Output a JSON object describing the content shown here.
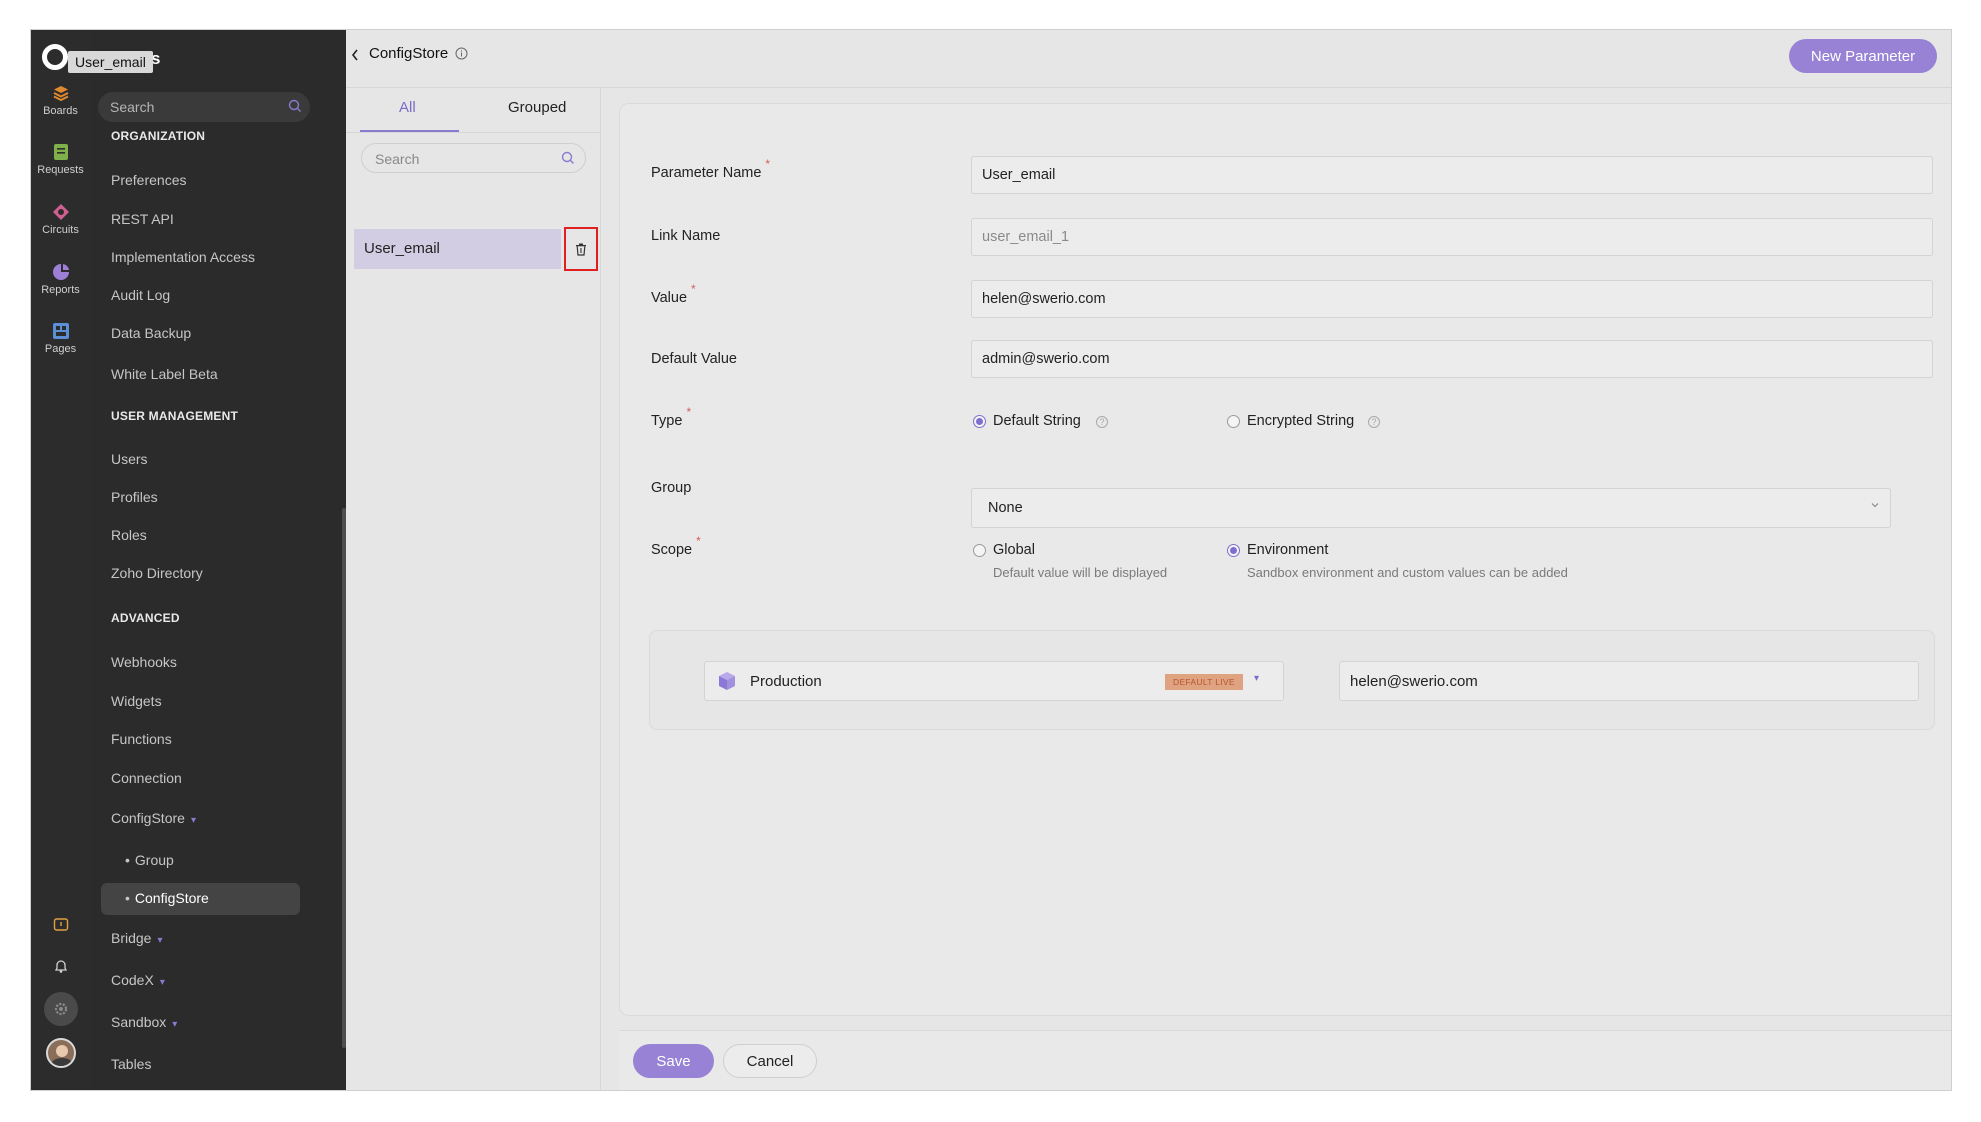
{
  "app": {
    "tooltip": "User_email",
    "title_fragment": "s"
  },
  "rail": {
    "items": [
      {
        "label": "Boards",
        "icon": "boards-icon"
      },
      {
        "label": "Requests",
        "icon": "requests-icon"
      },
      {
        "label": "Circuits",
        "icon": "circuits-icon"
      },
      {
        "label": "Reports",
        "icon": "reports-icon"
      },
      {
        "label": "Pages",
        "icon": "pages-icon"
      }
    ],
    "colors": {
      "boards": "#e08a2e",
      "requests": "#7fb04a",
      "circuits": "#d06090",
      "reports": "#9d7fd6",
      "pages": "#5b8fd6"
    }
  },
  "sidebar": {
    "search_placeholder": "Search",
    "sections": {
      "organization": "ORGANIZATION",
      "user_management": "USER MANAGEMENT",
      "advanced": "ADVANCED"
    },
    "org_items": [
      "Preferences",
      "REST API",
      "Implementation Access",
      "Audit Log",
      "Data Backup",
      "White Label Beta"
    ],
    "user_items": [
      "Users",
      "Profiles",
      "Roles",
      "Zoho Directory"
    ],
    "advanced_items": [
      "Webhooks",
      "Widgets",
      "Functions",
      "Connection",
      "ConfigStore"
    ],
    "configstore_sub": [
      "Group",
      "ConfigStore"
    ],
    "more_items": [
      "Bridge",
      "CodeX",
      "Sandbox",
      "Tables"
    ]
  },
  "header": {
    "title": "ConfigStore",
    "new_button": "New Parameter"
  },
  "list_panel": {
    "tabs": [
      "All",
      "Grouped"
    ],
    "search_placeholder": "Search",
    "selected_item": "User_email"
  },
  "form": {
    "parameter_name": {
      "label": "Parameter Name",
      "value": "User_email"
    },
    "link_name": {
      "label": "Link Name",
      "value": "user_email_1"
    },
    "value": {
      "label": "Value",
      "value": "helen@swerio.com"
    },
    "default_value": {
      "label": "Default Value",
      "value": "admin@swerio.com"
    },
    "type": {
      "label": "Type",
      "options": [
        "Default String",
        "Encrypted String"
      ],
      "selected": "Default String"
    },
    "group": {
      "label": "Group",
      "value": "None"
    },
    "scope": {
      "label": "Scope",
      "options": [
        {
          "label": "Global",
          "desc": "Default value will be displayed"
        },
        {
          "label": "Environment",
          "desc": "Sandbox environment and custom values can be added"
        }
      ],
      "selected": "Environment"
    },
    "environment": {
      "name": "Production",
      "badge": "DEFAULT LIVE",
      "value": "helen@swerio.com"
    },
    "required_marker": "*"
  },
  "footer": {
    "save": "Save",
    "cancel": "Cancel"
  },
  "accent_color": "#9782d5"
}
